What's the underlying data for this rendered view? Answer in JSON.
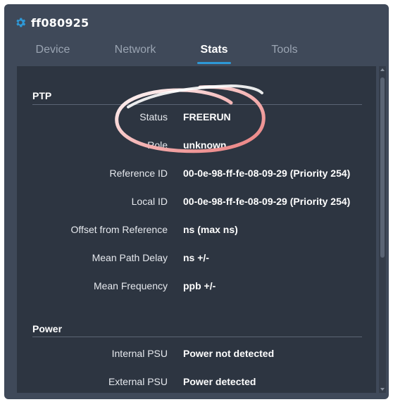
{
  "header": {
    "title": "ff080925",
    "icon": "gear-icon",
    "accent": "#2e98d6"
  },
  "tabs": [
    {
      "label": "Device",
      "active": false
    },
    {
      "label": "Network",
      "active": false
    },
    {
      "label": "Stats",
      "active": true
    },
    {
      "label": "Tools",
      "active": false
    }
  ],
  "sections": {
    "ptp": {
      "title": "PTP",
      "rows": [
        {
          "label": "Status",
          "value": "FREERUN"
        },
        {
          "label": "Role",
          "value": "unknown"
        },
        {
          "label": "Reference ID",
          "value": "00-0e-98-ff-fe-08-09-29 (Priority 254)"
        },
        {
          "label": "Local ID",
          "value": "00-0e-98-ff-fe-08-09-29 (Priority 254)"
        },
        {
          "label": "Offset from Reference",
          "value": "ns (max ns)"
        },
        {
          "label": "Mean Path Delay",
          "value": "ns +/-"
        },
        {
          "label": "Mean Frequency",
          "value": "ppb +/-"
        }
      ]
    },
    "power": {
      "title": "Power",
      "rows": [
        {
          "label": "Internal PSU",
          "value": "Power not detected"
        },
        {
          "label": "External PSU",
          "value": "Power detected"
        }
      ]
    }
  },
  "annotation": {
    "color": "#f08a8a",
    "shape": "ellipse-circle"
  }
}
